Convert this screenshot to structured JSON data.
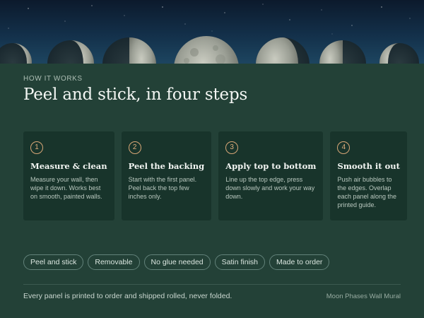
{
  "hero": {
    "moon_icon_names": [
      "moon-phase-icon"
    ]
  },
  "section": {
    "eyebrow": "HOW IT WORKS",
    "title": "Peel and stick, in four steps"
  },
  "steps": [
    {
      "number": "1",
      "title": "Measure & clean",
      "text": "Measure your wall, then wipe it down. Works best on smooth, painted walls."
    },
    {
      "number": "2",
      "title": "Peel the backing",
      "text": "Start with the first panel. Peel back the top few inches only."
    },
    {
      "number": "3",
      "title": "Apply top to bottom",
      "text": "Line up the top edge, press down slowly and work your way down."
    },
    {
      "number": "4",
      "title": "Smooth it out",
      "text": "Push air bubbles to the edges. Overlap each panel along the printed guide."
    }
  ],
  "chips": [
    "Peel and stick",
    "Removable",
    "No glue needed",
    "Satin finish",
    "Made to order"
  ],
  "footer": {
    "note": "Every panel is printed to order and shipped rolled, never folded.",
    "product": "Moon Phases Wall Mural"
  },
  "colors": {
    "background": "#234137",
    "card": "#18342b",
    "accent": "#d8a777",
    "chip_border": "#62827a"
  }
}
